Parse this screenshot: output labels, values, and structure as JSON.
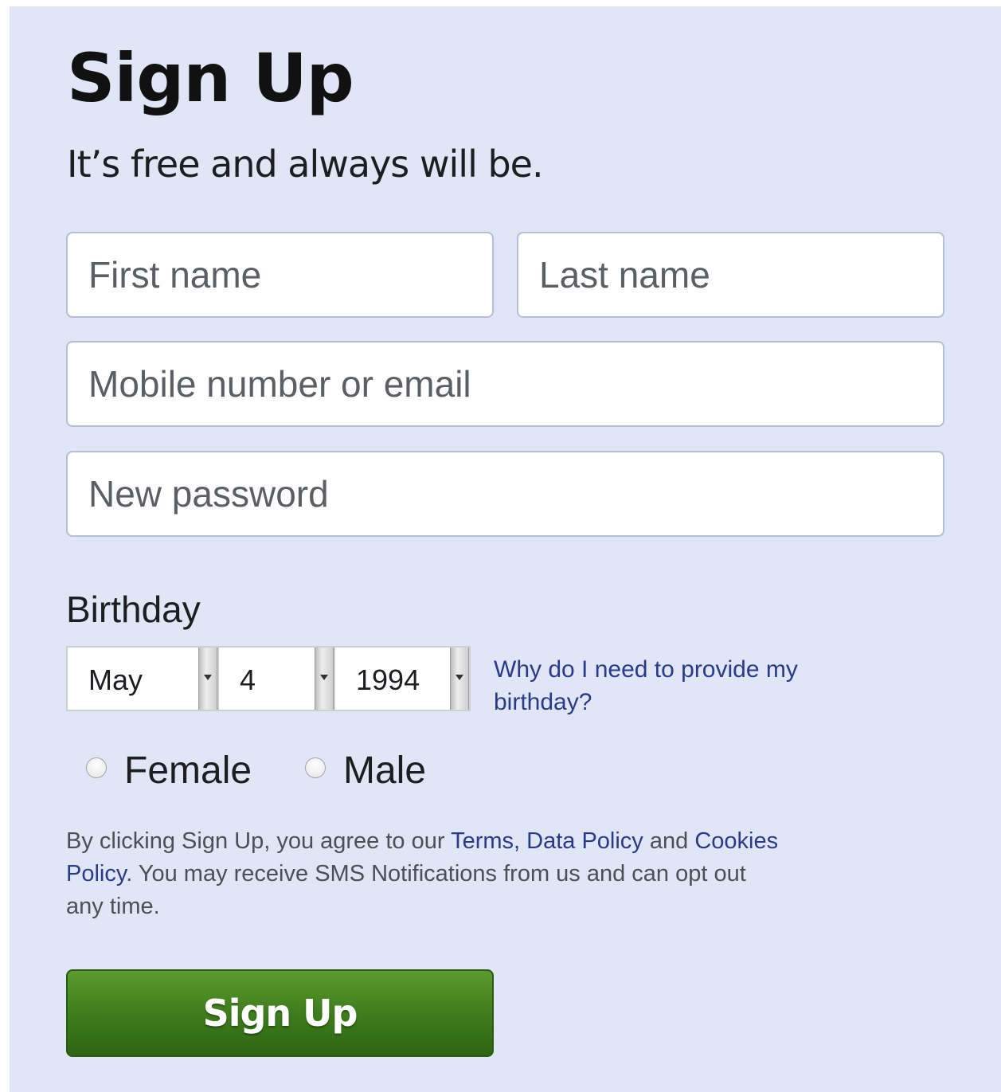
{
  "header": {
    "title": "Sign Up",
    "subtitle": "It’s free and always will be."
  },
  "form": {
    "first_name_placeholder": "First name",
    "last_name_placeholder": "Last name",
    "mobile_placeholder": "Mobile number or email",
    "password_placeholder": "New password"
  },
  "birthday": {
    "label": "Birthday",
    "month": "May",
    "day": "4",
    "year": "1994",
    "why_link": "Why do I need to provide my birthday?"
  },
  "gender": {
    "female_label": "Female",
    "male_label": "Male"
  },
  "terms": {
    "part1": "By clicking Sign Up, you agree to our ",
    "terms_link": "Terms",
    "sep": ", ",
    "data_policy_link": "Data Policy",
    "part2": " and ",
    "cookies_link": "Cookies Policy",
    "part3": ". You may receive SMS Notifications from us and can opt out any time."
  },
  "submit": {
    "label": "Sign Up"
  },
  "colors": {
    "panel_bg": "#e0e6f5",
    "link": "#2a3a8a",
    "button_green": "#3c7a1b"
  }
}
